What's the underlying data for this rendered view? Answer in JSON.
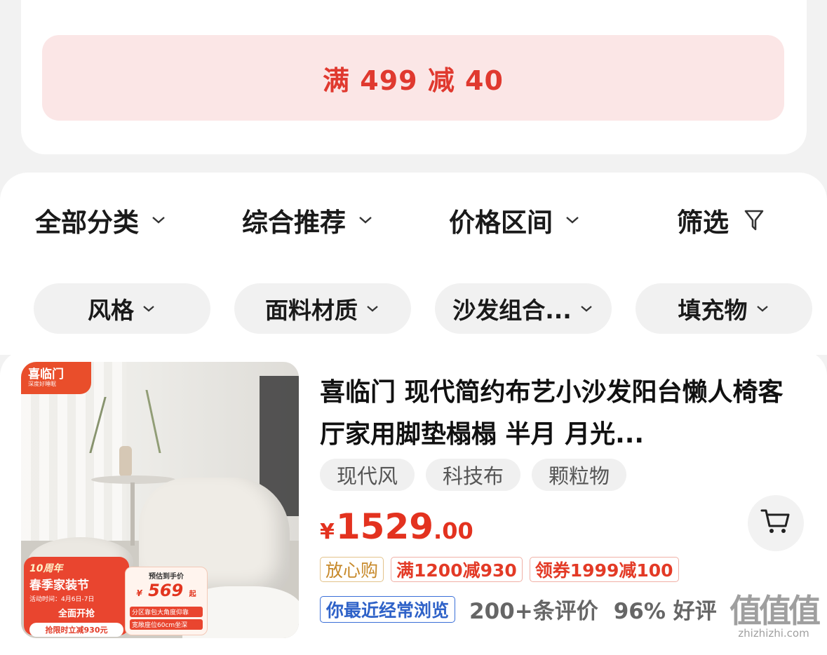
{
  "coupon": {
    "text": "满 499 减 40",
    "color": "#e0392f",
    "background": "#fbe6e6"
  },
  "sort_tabs": [
    {
      "label": "全部分类",
      "icon": "chevron-down-icon"
    },
    {
      "label": "综合推荐",
      "icon": "chevron-down-icon"
    },
    {
      "label": "价格区间",
      "icon": "chevron-down-icon"
    },
    {
      "label": "筛选",
      "icon": "filter-icon"
    }
  ],
  "filter_chips": [
    {
      "label": "风格"
    },
    {
      "label": "面料材质"
    },
    {
      "label": "沙发组合..."
    },
    {
      "label": "填充物"
    }
  ],
  "product": {
    "title": "喜临门 现代简约布艺小沙发阳台懒人椅客厅家用脚垫榻榻 半月 月光...",
    "tags": [
      "现代风",
      "科技布",
      "颗粒物"
    ],
    "price": {
      "currency": "¥",
      "integer": "1529",
      "decimal": ".00"
    },
    "badges": [
      "放心购",
      "满1200减930",
      "领券1999减100"
    ],
    "browse_tag": "你最近经常浏览",
    "reviews": "200+条评价",
    "rating": "96% 好评",
    "image": {
      "brand": "喜临门",
      "brand_slogan": "深度好睡眠",
      "anniversary": "10周年",
      "festival": "春季家装节",
      "activity_time": "活动时间：4月6日-7日",
      "open": "全面开抢",
      "limited_cut": "抢限时立减930元",
      "est_label": "预估到手价",
      "est_currency": "¥",
      "est_price": "569",
      "est_suffix": "起",
      "feature1": "分区靠包大角度仰靠",
      "feature2": "宽敞座位60cm坐深"
    },
    "price_color": "#e3321f"
  },
  "watermark": {
    "logo": "值值值",
    "url": "zhizhizhi.com"
  }
}
